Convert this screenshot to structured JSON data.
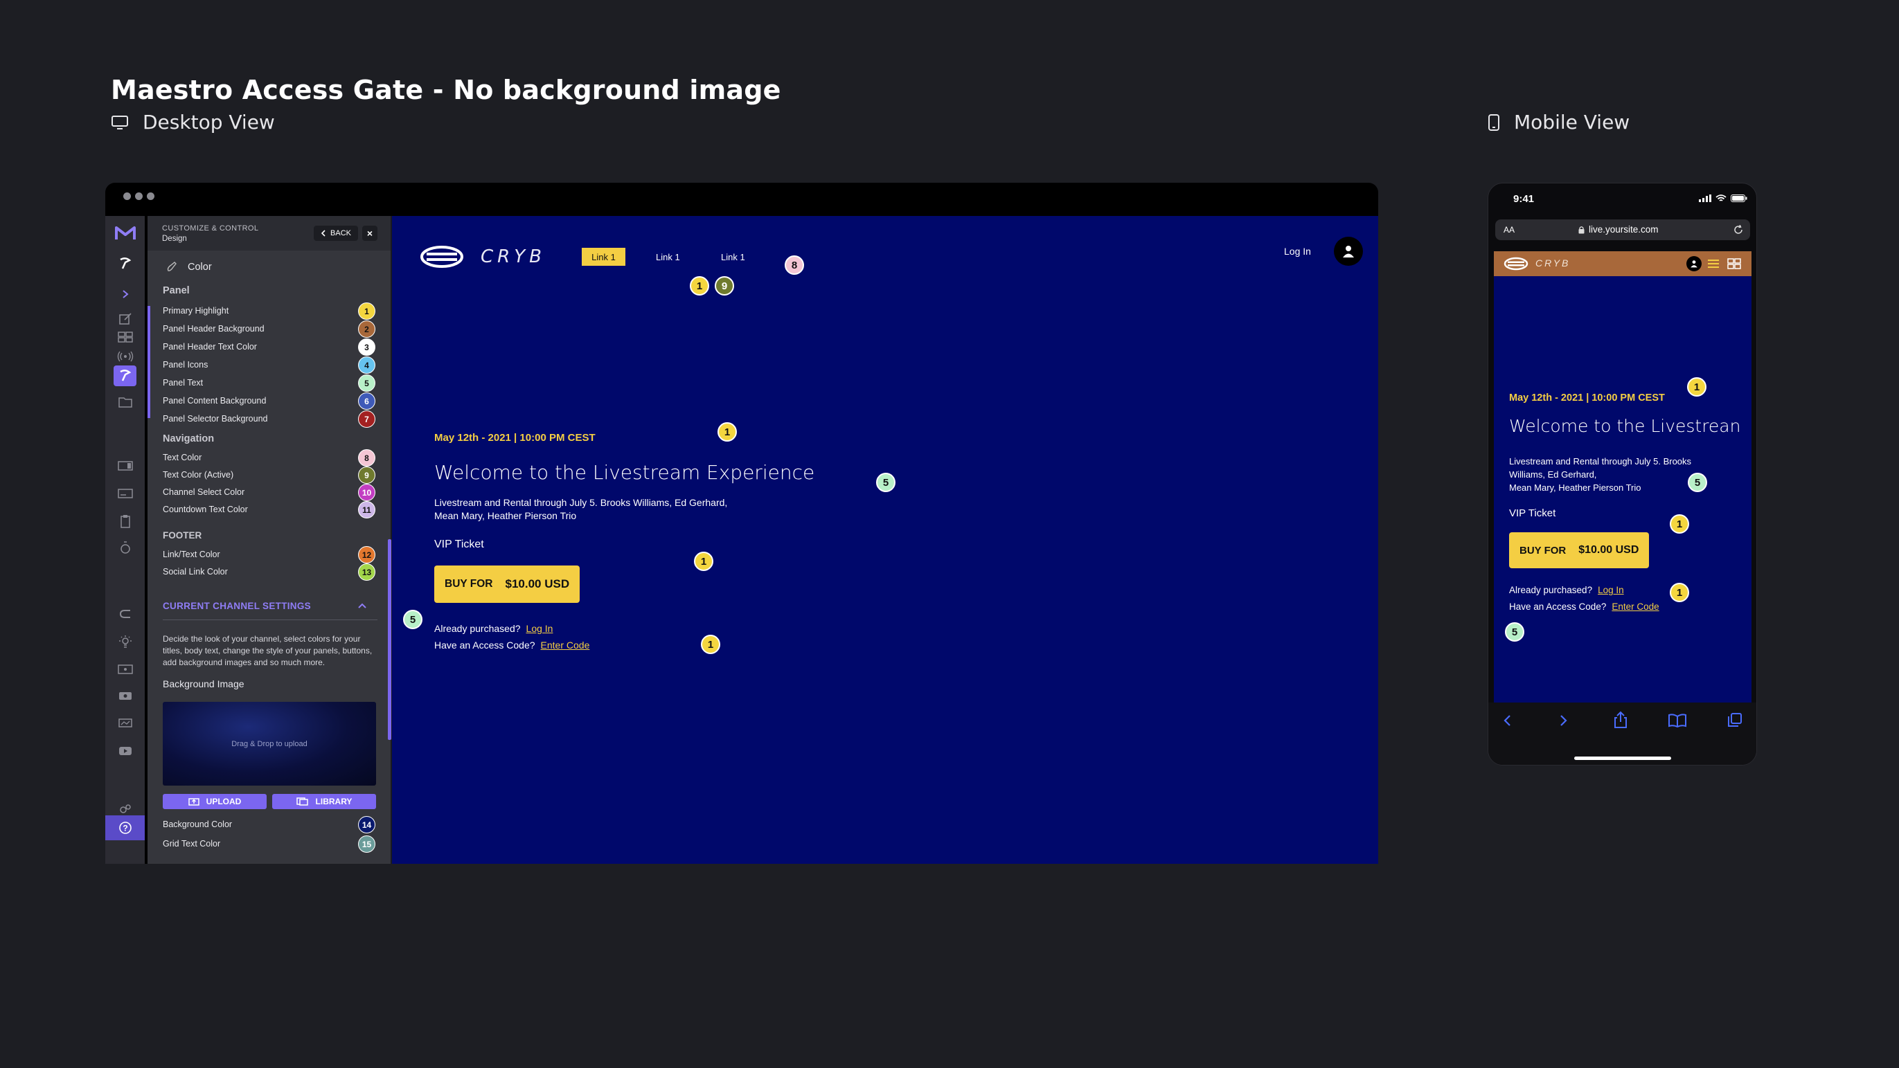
{
  "page": {
    "title": "Maestro Access Gate - No background image",
    "desktop_label": "Desktop View",
    "mobile_label": "Mobile View"
  },
  "panel": {
    "header_line1": "CUSTOMIZE & CONTROL",
    "header_line2": "Design",
    "back_label": "BACK",
    "close_label": "×",
    "color_heading": "Color",
    "sections": {
      "panel": "Panel",
      "navigation": "Navigation",
      "footer": "FOOTER",
      "channel": "CURRENT CHANNEL SETTINGS",
      "background_image": "Background Image"
    },
    "panel_items": [
      {
        "label": "Primary Highlight",
        "num": "1",
        "color": "#f4d63f"
      },
      {
        "label": "Panel Header Background",
        "num": "2",
        "color": "#a8683a"
      },
      {
        "label": "Panel Header Text Color",
        "num": "3",
        "color": "#ffffff"
      },
      {
        "label": "Panel Icons",
        "num": "4",
        "color": "#66c3ef"
      },
      {
        "label": "Panel Text",
        "num": "5",
        "color": "#b8f0c8"
      },
      {
        "label": "Panel Content Background",
        "num": "6",
        "color": "#3f5ab8"
      },
      {
        "label": "Panel Selector Background",
        "num": "7",
        "color": "#a32121"
      }
    ],
    "nav_items": [
      {
        "label": "Text Color",
        "num": "8",
        "color": "#f4c6d4"
      },
      {
        "label": "Text Color (Active)",
        "num": "9",
        "color": "#6f7a2e"
      },
      {
        "label": "Channel Select Color",
        "num": "10",
        "color": "#c23dc2"
      },
      {
        "label": "Countdown Text Color",
        "num": "11",
        "color": "#cdb7e8"
      }
    ],
    "footer_items": [
      {
        "label": "Link/Text Color",
        "num": "12",
        "color": "#e2772e"
      },
      {
        "label": "Social Link Color",
        "num": "13",
        "color": "#a3d64a"
      }
    ],
    "channel_description": "Decide the look of your channel, select colors for your titles, body text, change the style of your panels, buttons, add background images and so much more.",
    "drop_text": "Drag & Drop to upload",
    "upload_label": "UPLOAD",
    "library_label": "LIBRARY",
    "bg_items": [
      {
        "label": "Background Color",
        "num": "14",
        "color": "#0a1a6e"
      },
      {
        "label": "Grid Text Color",
        "num": "15",
        "color": "#6a9c9a"
      }
    ]
  },
  "site": {
    "logo": "CRYB",
    "nav": [
      "Link 1",
      "Link 1",
      "Link 1"
    ],
    "login": "Log In",
    "date": "May 12th - 2021 | 10:00 PM CEST",
    "headline": "Welcome to the Livestream Experience",
    "mobile_headline": "Welcome to the Livestrean",
    "description_line1": "Livestream and Rental through July 5. Brooks Williams, Ed Gerhard,",
    "description_line2": "Mean Mary, Heather Pierson Trio",
    "m_desc1": "Livestream and Rental through July 5. Brooks",
    "m_desc2": "Williams, Ed Gerhard,",
    "m_desc3": "Mean Mary, Heather Pierson Trio",
    "ticket_label": "VIP Ticket",
    "buy_prefix": "BUY FOR",
    "price": "$10.00 USD",
    "already_purchased": "Already purchased?",
    "login_link": "Log In",
    "access_code": "Have an Access Code?",
    "enter_code": "Enter Code"
  },
  "badges": {
    "n1": "1",
    "n5": "5",
    "n8": "8",
    "n9": "9",
    "c1": "#f4d63f",
    "c5": "#b8f0c8",
    "c8": "#f4c6d4",
    "c9": "#6f7a2e"
  },
  "mobile": {
    "time": "9:41",
    "text_size": "AA",
    "url": "live.yoursite.com"
  },
  "colors": {
    "canvas_bg": "#00086b",
    "accent": "#7b66f0",
    "highlight": "#f4ce43",
    "mobile_header": "#a8683a"
  }
}
